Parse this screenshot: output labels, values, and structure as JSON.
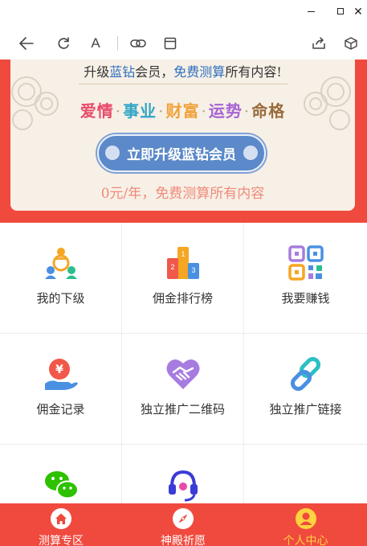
{
  "window": {
    "controls": [
      "minimize-icon",
      "maximize-icon",
      "close-icon"
    ],
    "close_glyph": "✕"
  },
  "toolbar": {
    "text_label": "A",
    "icons": [
      "back-arrow-icon",
      "refresh-icon",
      "font-size-icon",
      "link-icon",
      "window-icon",
      "share-icon",
      "cube-icon"
    ]
  },
  "banner": {
    "headline_1": "升级",
    "headline_2": "蓝钻",
    "headline_3": "会员，",
    "headline_4": "免费测算",
    "headline_5": "所有内容!",
    "fortunes": [
      {
        "text": "爱情",
        "color": "#e84a6a"
      },
      {
        "text": "事业",
        "color": "#33a6c8"
      },
      {
        "text": "财富",
        "color": "#f0a23a"
      },
      {
        "text": "运势",
        "color": "#a765d4"
      },
      {
        "text": "命格",
        "color": "#9a6a3c"
      }
    ],
    "separator": "·",
    "upgrade_button": "立即升级蓝钻会员",
    "price_text": "0元/年，免费测算所有内容"
  },
  "grid": {
    "items": [
      {
        "label": "我的下级",
        "icon": "team-network-icon"
      },
      {
        "label": "佣金排行榜",
        "icon": "podium-ranking-icon"
      },
      {
        "label": "我要赚钱",
        "icon": "qr-code-icon"
      },
      {
        "label": "佣金记录",
        "icon": "yen-coin-hand-icon"
      },
      {
        "label": "独立推广二维码",
        "icon": "handshake-heart-icon"
      },
      {
        "label": "独立推广链接",
        "icon": "chain-link-icon"
      },
      {
        "label": "",
        "icon": "wechat-icon"
      },
      {
        "label": "",
        "icon": "headset-service-icon"
      },
      {
        "label": "",
        "icon": ""
      }
    ]
  },
  "bottom_nav": {
    "items": [
      {
        "label": "测算专区",
        "icon": "home-icon",
        "active": false
      },
      {
        "label": "神殿祈愿",
        "icon": "compass-icon",
        "active": false
      },
      {
        "label": "个人中心",
        "icon": "user-icon",
        "active": true
      }
    ],
    "active_color": "#ffd23f",
    "bar_color": "#f04a3e"
  }
}
